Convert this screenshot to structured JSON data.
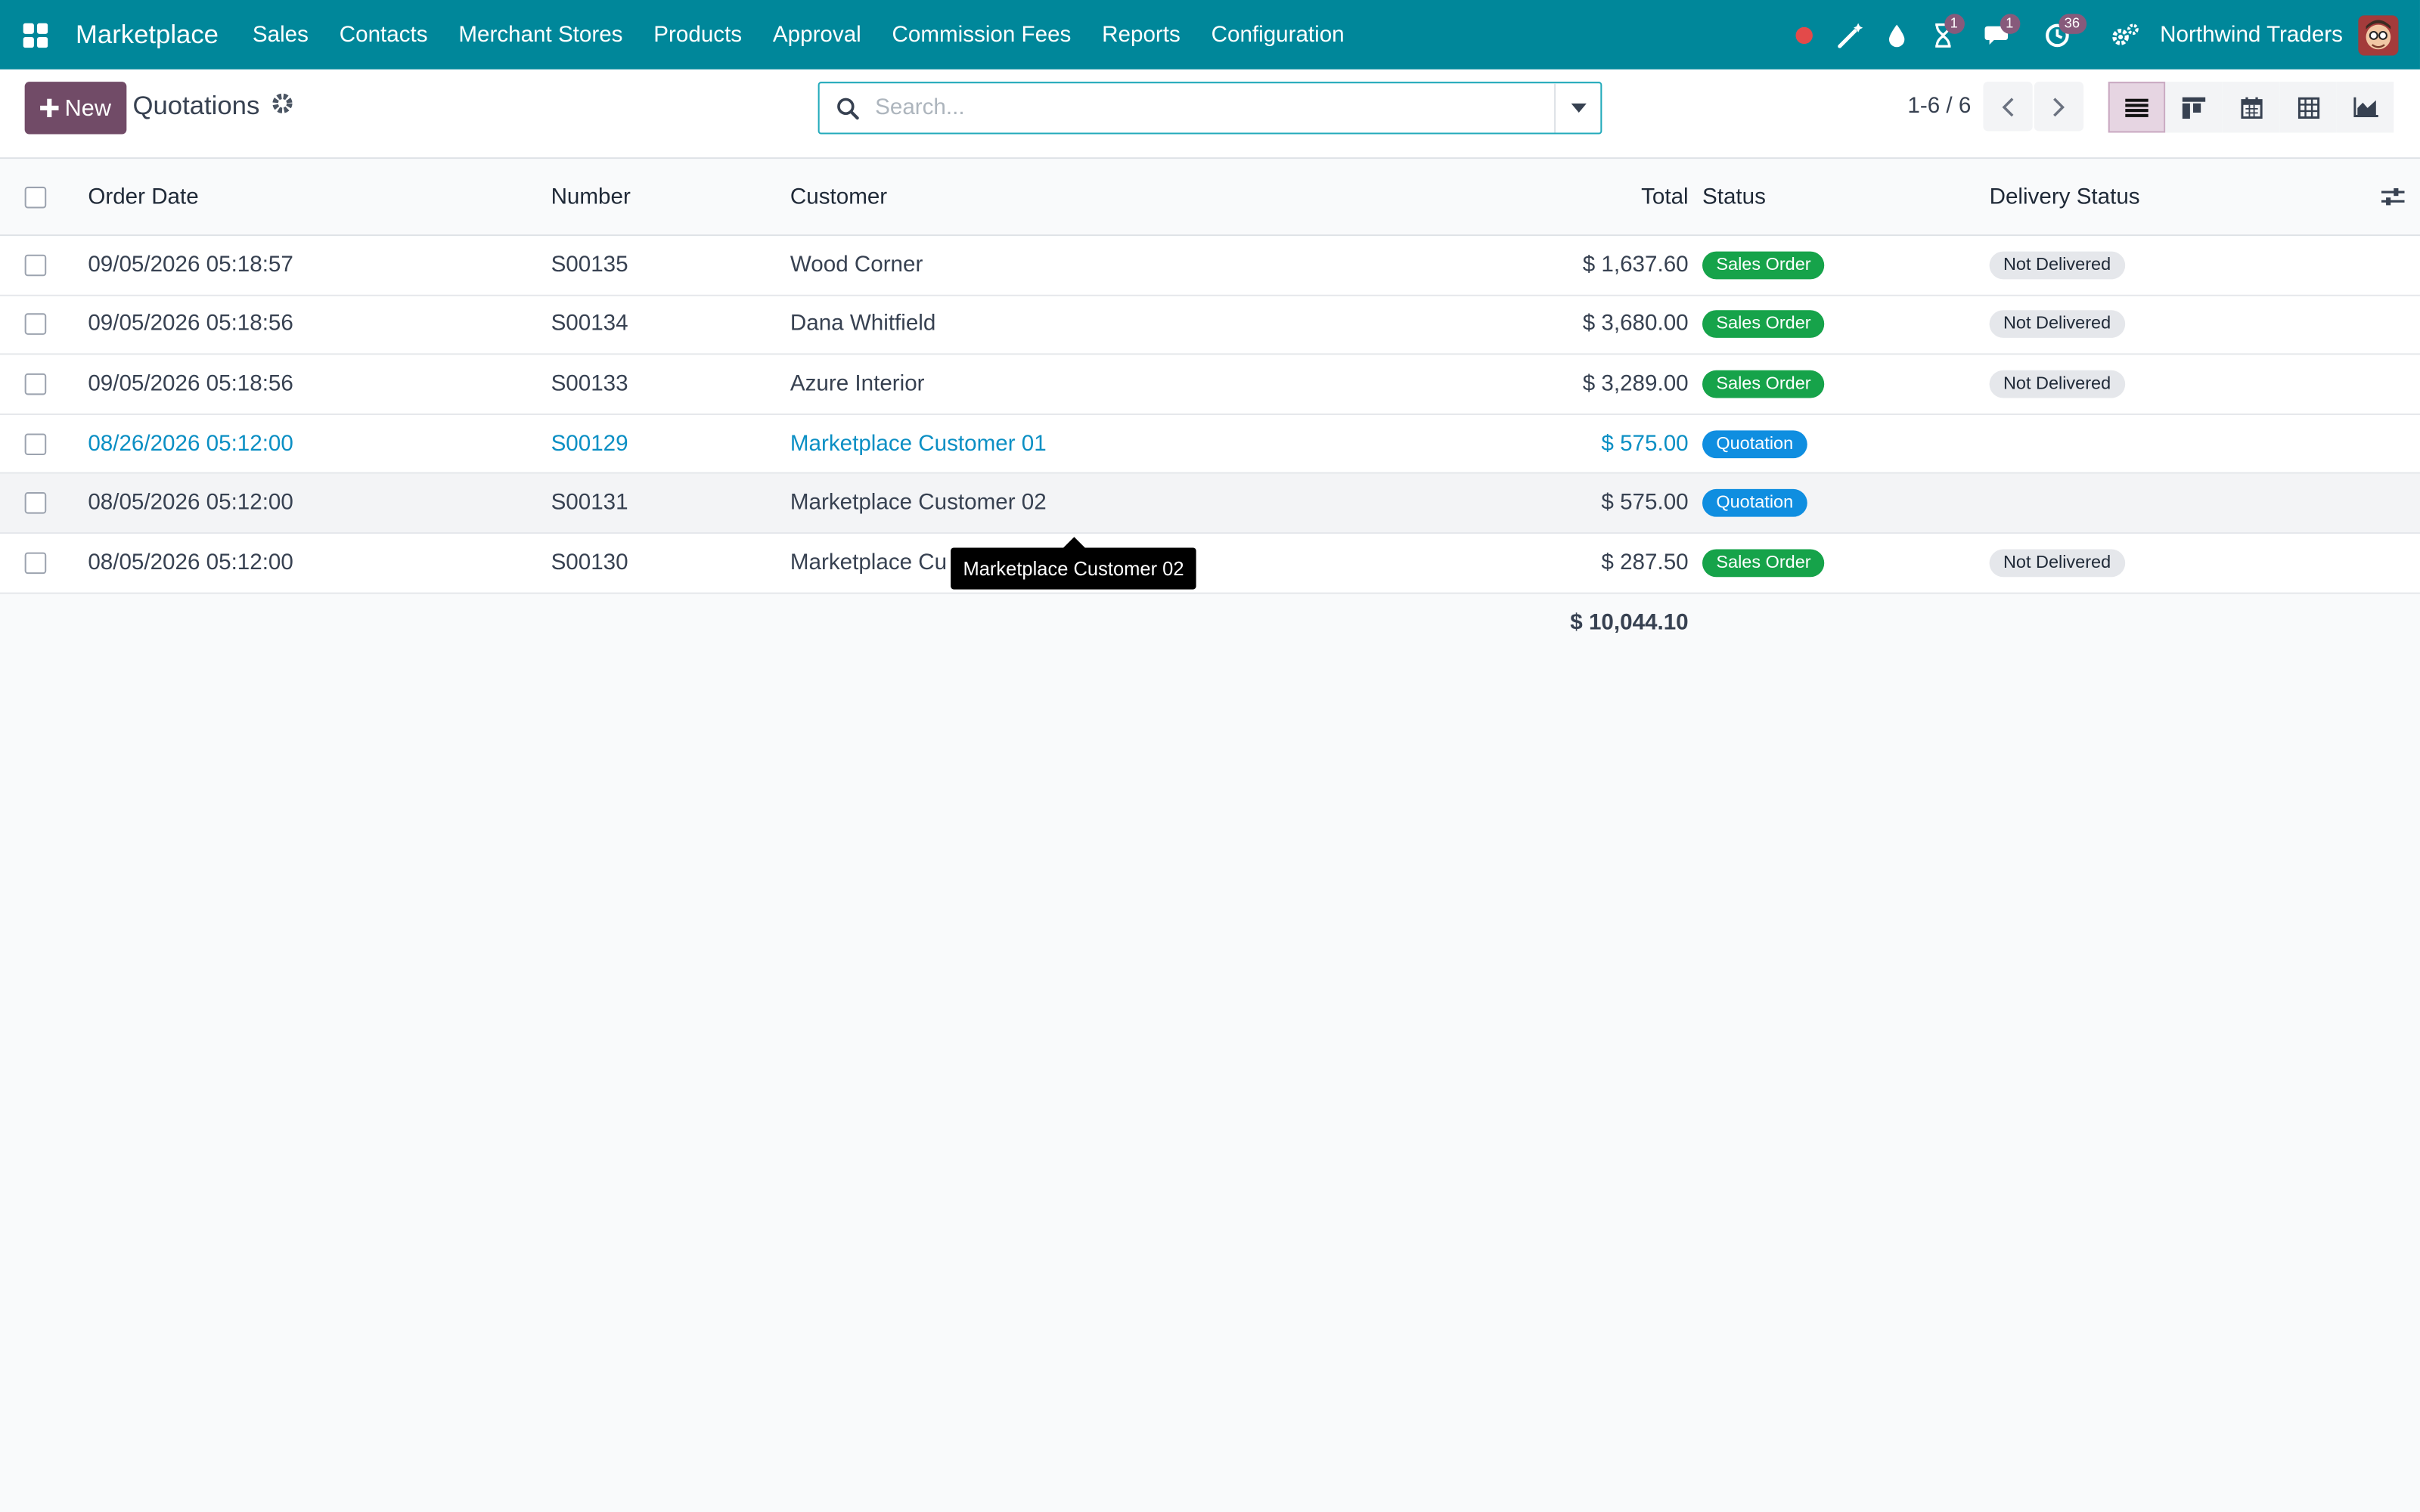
{
  "navbar": {
    "brand": "Marketplace",
    "menu": [
      "Sales",
      "Contacts",
      "Merchant Stores",
      "Products",
      "Approval",
      "Commission Fees",
      "Reports",
      "Configuration"
    ],
    "badges": {
      "activities": "1",
      "messages": "1",
      "timesheets": "36"
    },
    "company": "Northwind Traders"
  },
  "control": {
    "new_label": "New",
    "title": "Quotations",
    "search_placeholder": "Search...",
    "pager": "1-6 / 6"
  },
  "table": {
    "headers": {
      "order_date": "Order Date",
      "number": "Number",
      "customer": "Customer",
      "total": "Total",
      "status": "Status",
      "delivery": "Delivery Status"
    },
    "rows": [
      {
        "date": "09/05/2026 05:18:57",
        "number": "S00135",
        "customer": "Wood Corner",
        "total": "$ 1,637.60",
        "status": "Sales Order",
        "delivery": "Not Delivered"
      },
      {
        "date": "09/05/2026 05:18:56",
        "number": "S00134",
        "customer": "Dana Whitfield",
        "total": "$ 3,680.00",
        "status": "Sales Order",
        "delivery": "Not Delivered"
      },
      {
        "date": "09/05/2026 05:18:56",
        "number": "S00133",
        "customer": "Azure Interior",
        "total": "$ 3,289.00",
        "status": "Sales Order",
        "delivery": "Not Delivered"
      },
      {
        "date": "08/26/2026 05:12:00",
        "number": "S00129",
        "customer": "Marketplace Customer 01",
        "total": "$ 575.00",
        "status": "Quotation",
        "delivery": ""
      },
      {
        "date": "08/05/2026 05:12:00",
        "number": "S00131",
        "customer": "Marketplace Customer 02",
        "total": "$ 575.00",
        "status": "Quotation",
        "delivery": ""
      },
      {
        "date": "08/05/2026 05:12:00",
        "number": "S00130",
        "customer": "Marketplace Cu",
        "total": "$ 287.50",
        "status": "Sales Order",
        "delivery": "Not Delivered"
      }
    ],
    "grand_total": "$ 10,044.10"
  },
  "tooltip": "Marketplace Customer 02",
  "colors": {
    "navbar": "#00879a",
    "primary": "#714b67",
    "sales_order": "#16a34a",
    "quotation": "#0f8ee0",
    "link": "#0b8fc4"
  }
}
